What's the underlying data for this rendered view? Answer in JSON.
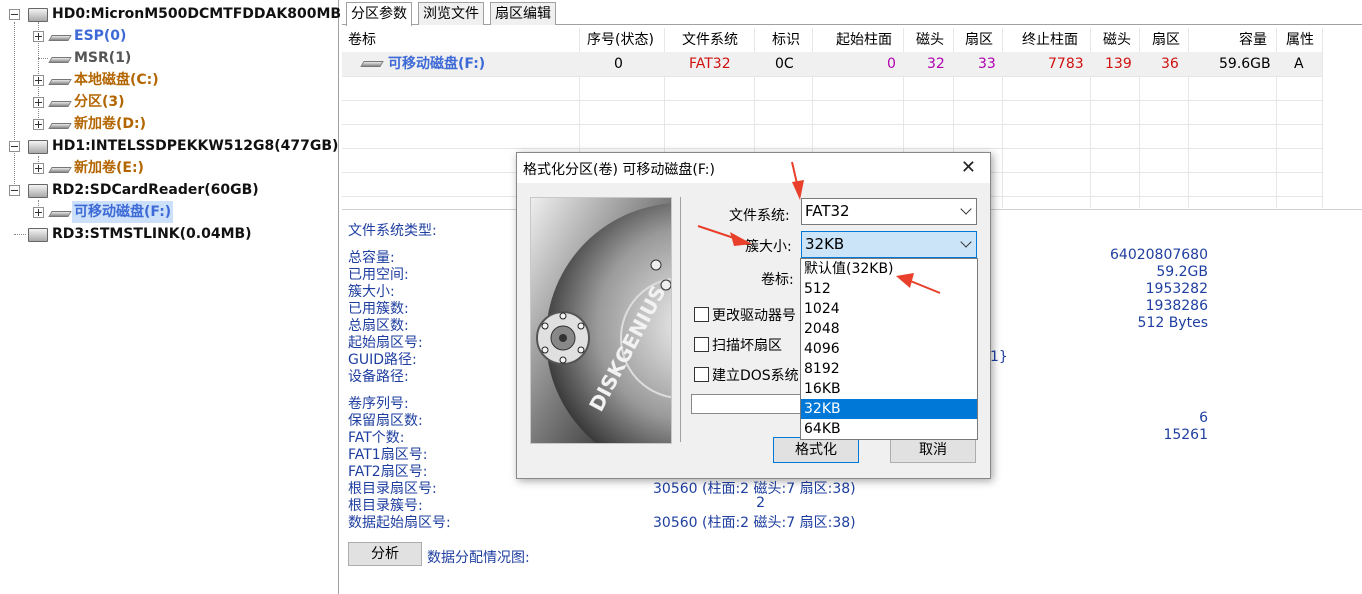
{
  "tree": {
    "hd0": "HD0:MicronM500DCMTFDDAK800MB",
    "hd0_parts": [
      "ESP(0)",
      "MSR(1)",
      "本地磁盘(C:)",
      "分区(3)",
      "新加卷(D:)"
    ],
    "hd1": "HD1:INTELSSDPEKKW512G8(477GB)",
    "hd1_parts": [
      "新加卷(E:)"
    ],
    "rd2": "RD2:SDCardReader(60GB)",
    "rd2_parts": [
      "可移动磁盘(F:)"
    ],
    "rd3": "RD3:STMSTLINK(0.04MB)"
  },
  "tabs": [
    "分区参数",
    "浏览文件",
    "扇区编辑"
  ],
  "grid": {
    "headers": [
      "卷标",
      "序号(状态)",
      "文件系统",
      "标识",
      "起始柱面",
      "磁头",
      "扇区",
      "终止柱面",
      "磁头",
      "扇区",
      "容量",
      "属性"
    ],
    "row": [
      "可移动磁盘(F:)",
      "0",
      "FAT32",
      "0C",
      "0",
      "32",
      "33",
      "7783",
      "139",
      "36",
      "59.6GB",
      "A"
    ]
  },
  "info": {
    "fs_type_label": "文件系统类型:",
    "labels1": [
      "总容量:",
      "已用空间:",
      "簇大小:",
      "已用簇数:",
      "总扇区数:",
      "起始扇区号:",
      "GUID路径:",
      "设备路径:"
    ],
    "values1": [
      "64020807680",
      "59.2GB",
      "1953282",
      "1938286",
      "512 Bytes"
    ],
    "guid_tail": "1}",
    "labels2": [
      "卷序列号:",
      "保留扇区数:",
      "FAT个数:",
      "FAT1扇区号:",
      "FAT2扇区号:",
      "根目录扇区号:",
      "根目录簇号:",
      "数据起始扇区号:"
    ],
    "values2": [
      "6",
      "15261"
    ],
    "root_sector": "30560 (柱面:2 磁头:7 扇区:38)",
    "root_cluster": "2",
    "data_start": "30560 (柱面:2 磁头:7 扇区:38)"
  },
  "bottom": {
    "analyze": "分析",
    "map_label": "数据分配情况图:"
  },
  "dialog": {
    "title": "格式化分区(卷) 可移动磁盘(F:)",
    "close": "✕",
    "fs_label": "文件系统:",
    "fs_value": "FAT32",
    "cluster_label": "簇大小:",
    "cluster_value": "32KB",
    "vol_label": "卷标:",
    "chk1": "更改驱动器号",
    "chk2": "扫描坏扇区",
    "chk3": "建立DOS系统",
    "format_btn": "格式化",
    "cancel_btn": "取消",
    "brand": "DISKGENIUS"
  },
  "dropdown": [
    "默认值(32KB)",
    "512",
    "1024",
    "2048",
    "4096",
    "8192",
    "16KB",
    "32KB",
    "64KB"
  ],
  "colors": {
    "accent": "#0078d7",
    "arrow": "#e8402a",
    "link": "#3d6ad6"
  }
}
